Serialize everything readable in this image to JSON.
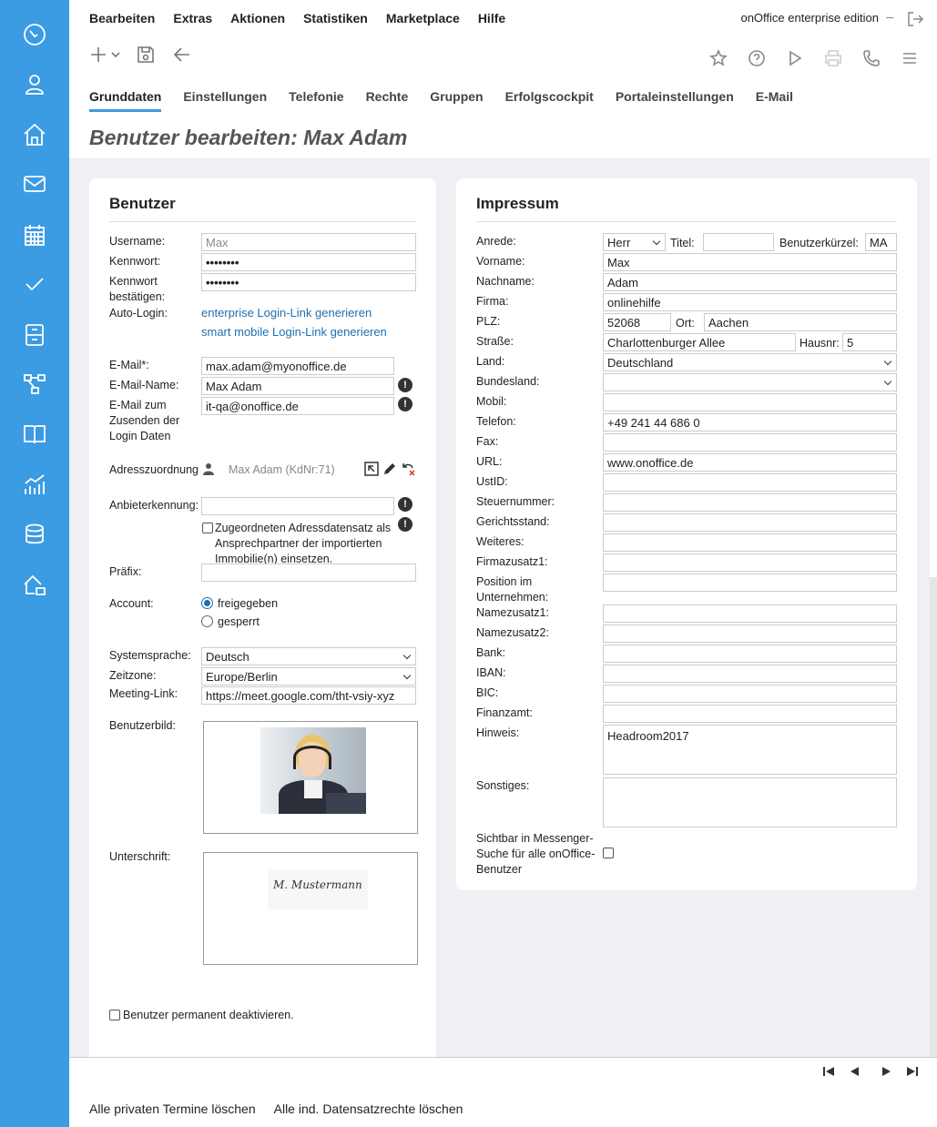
{
  "menu": [
    "Bearbeiten",
    "Extras",
    "Aktionen",
    "Statistiken",
    "Marketplace",
    "Hilfe"
  ],
  "edition": "onOffice enterprise edition",
  "edition_dash": "–",
  "tabs": [
    "Grunddaten",
    "Einstellungen",
    "Telefonie",
    "Rechte",
    "Gruppen",
    "Erfolgscockpit",
    "Portaleinstellungen",
    "E-Mail"
  ],
  "page_title": "Benutzer bearbeiten: Max Adam",
  "benutzer": {
    "title": "Benutzer",
    "username_label": "Username:",
    "username_value": "Max",
    "kennwort_label": "Kennwort:",
    "kennwort_value": "••••••••",
    "kennwort2_label": "Kennwort bestätigen:",
    "kennwort2_value": "••••••••",
    "autologin_label": "Auto-Login:",
    "link_enterprise": "enterprise Login-Link generieren",
    "link_mobile": "smart mobile Login-Link generieren",
    "email_label": "E-Mail*:",
    "email_value": "max.adam@myonoffice.de",
    "emailname_label": "E-Mail-Name:",
    "emailname_value": "Max Adam",
    "email_send_label": "E-Mail zum Zusenden der Login Daten",
    "email_send_value": "it-qa@onoffice.de",
    "adresszuordnung_label": "Adresszuordnung",
    "adresszuordnung_value": "Max Adam (KdNr:71)",
    "anbieter_label": "Anbieterkennung:",
    "anbieter_value": "",
    "zugeordnet_text": "Zugeordneten Adressdatensatz als Ansprechpartner der importierten Immobilie(n) einsetzen.",
    "praefix_label": "Präfix:",
    "praefix_value": "",
    "account_label": "Account:",
    "account_opt1": "freigegeben",
    "account_opt2": "gesperrt",
    "systemsprache_label": "Systemsprache:",
    "systemsprache_value": "Deutsch",
    "zeitzone_label": "Zeitzone:",
    "zeitzone_value": "Europe/Berlin",
    "meeting_label": "Meeting-Link:",
    "meeting_value": "https://meet.google.com/tht-vsiy-xyz",
    "bild_label": "Benutzerbild:",
    "unterschrift_label": "Unterschrift:",
    "unterschrift_text": "M. Mustermann",
    "deaktivieren_label": "Benutzer permanent deaktivieren."
  },
  "impressum": {
    "title": "Impressum",
    "anrede_label": "Anrede:",
    "anrede_value": "Herr",
    "titel_label": "Titel:",
    "titel_value": "",
    "kuerzel_label": "Benutzerkürzel:",
    "kuerzel_value": "MA",
    "vorname_label": "Vorname:",
    "vorname_value": "Max",
    "nachname_label": "Nachname:",
    "nachname_value": "Adam",
    "firma_label": "Firma:",
    "firma_value": "onlinehilfe",
    "plz_label": "PLZ:",
    "plz_value": "52068",
    "ort_label": "Ort:",
    "ort_value": "Aachen",
    "strasse_label": "Straße:",
    "strasse_value": "Charlottenburger Allee",
    "hausnr_label": "Hausnr:",
    "hausnr_value": "5",
    "land_label": "Land:",
    "land_value": "Deutschland",
    "bundesland_label": "Bundesland:",
    "bundesland_value": "",
    "mobil_label": "Mobil:",
    "mobil_value": "",
    "telefon_label": "Telefon:",
    "telefon_value": "+49 241 44 686 0",
    "fax_label": "Fax:",
    "fax_value": "",
    "url_label": "URL:",
    "url_value": "www.onoffice.de",
    "ustid_label": "UstID:",
    "ustid_value": "",
    "steuernummer_label": "Steuernummer:",
    "steuernummer_value": "",
    "gerichtsstand_label": "Gerichtsstand:",
    "gerichtsstand_value": "",
    "weiteres_label": "Weiteres:",
    "weiteres_value": "",
    "firmazusatz_label": "Firmazusatz1:",
    "firmazusatz_value": "",
    "position_label": "Position im Unternehmen:",
    "position_value": "",
    "namezusatz1_label": "Namezusatz1:",
    "namezusatz1_value": "",
    "namezusatz2_label": "Namezusatz2:",
    "namezusatz2_value": "",
    "bank_label": "Bank:",
    "bank_value": "",
    "iban_label": "IBAN:",
    "iban_value": "",
    "bic_label": "BIC:",
    "bic_value": "",
    "finanzamt_label": "Finanzamt:",
    "finanzamt_value": "",
    "hinweis_label": "Hinweis:",
    "hinweis_value": "Headroom2017",
    "sonstiges_label": "Sonstiges:",
    "sonstiges_value": "",
    "sichtbar_label": "Sichtbar in Messenger-Suche für alle onOffice-Benutzer"
  },
  "footer": {
    "link1": "Alle privaten Termine löschen",
    "link2": "Alle ind. Datensatzrechte löschen"
  },
  "sidebar_icons": [
    "dashboard-icon",
    "user-icon",
    "home-icon",
    "mail-icon",
    "calendar-icon",
    "check-icon",
    "file-cabinet-icon",
    "workflow-icon",
    "book-icon",
    "statistics-icon",
    "database-icon",
    "house-hand-icon"
  ],
  "colors": {
    "sidebar": "#3b9be3",
    "accent": "#3b9be3",
    "link": "#1e6fb0",
    "content_bg": "#eef0f3"
  }
}
